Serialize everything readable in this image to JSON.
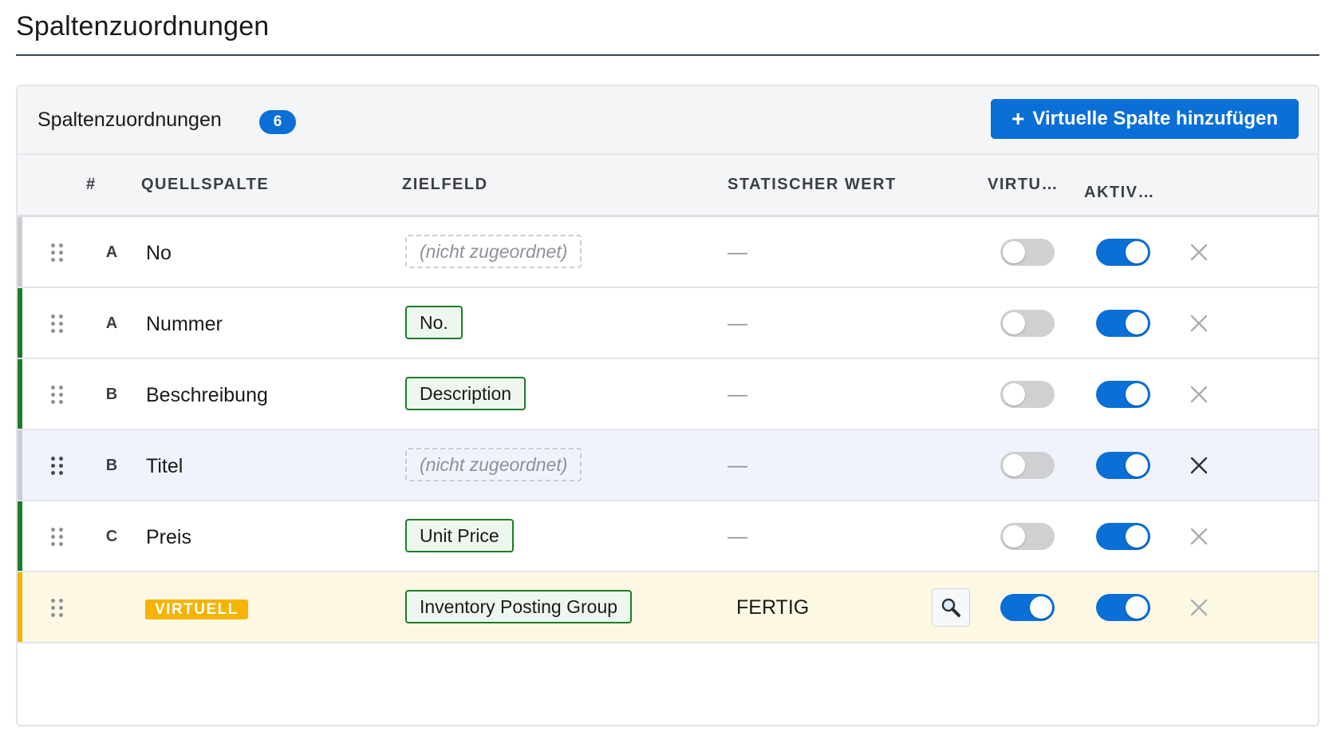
{
  "page": {
    "title": "Spaltenzuordnungen"
  },
  "panel": {
    "title": "Spaltenzuordnungen",
    "count": "6",
    "add_button": {
      "icon": "plus-icon",
      "label": "Virtuelle Spalte hinzufügen"
    }
  },
  "columns": {
    "hash": "#",
    "source": "QUELLSPALTE",
    "target": "ZIELFELD",
    "static": "STATISCHER WERT",
    "virtual": "VIRTU…",
    "active": "AKTIV…"
  },
  "colors": {
    "accent_blue": "#0a6fd6",
    "mapped_green": "#1c7d28",
    "virtual_amber": "#f5b400",
    "unmapped_gray": "#c9ccd0"
  },
  "rows": [
    {
      "letter": "A",
      "source": "No",
      "target": "(nicht zugeordnet)",
      "mapped": false,
      "static": "—",
      "virtual": false,
      "active": true
    },
    {
      "letter": "A",
      "source": "Nummer",
      "target": "No.",
      "mapped": true,
      "static": "—",
      "virtual": false,
      "active": true
    },
    {
      "letter": "B",
      "source": "Beschreibung",
      "target": "Description",
      "mapped": true,
      "static": "—",
      "virtual": false,
      "active": true
    },
    {
      "letter": "B",
      "source": "Titel",
      "target": "(nicht zugeordnet)",
      "mapped": false,
      "static": "—",
      "virtual": false,
      "active": true,
      "hovered": true
    },
    {
      "letter": "C",
      "source": "Preis",
      "target": "Unit Price",
      "mapped": true,
      "static": "—",
      "virtual": false,
      "active": true
    },
    {
      "letter": "",
      "source_badge": "VIRTUELL",
      "target": "Inventory Posting Group",
      "mapped": true,
      "static": "FERTIG",
      "virtual": true,
      "active": true,
      "lookup_icon": "magnifier-icon"
    }
  ]
}
